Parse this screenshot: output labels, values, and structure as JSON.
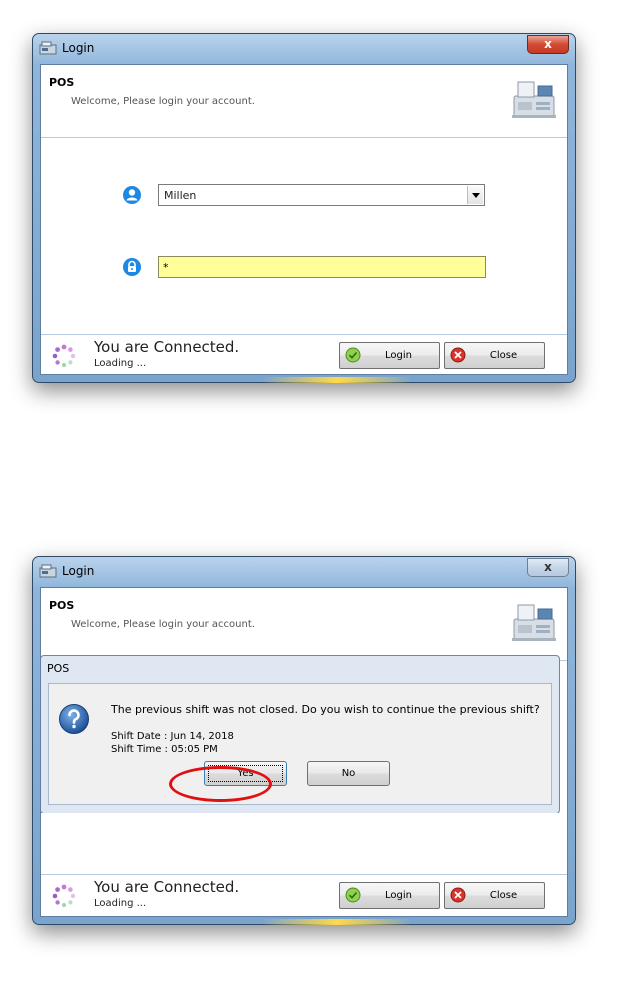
{
  "window": {
    "title": "Login",
    "close_glyph": "x",
    "icon": "login-app-icon"
  },
  "header": {
    "title": "POS",
    "subtitle": "Welcome, Please login your account."
  },
  "form": {
    "user_value": "Millen",
    "password_value": "*"
  },
  "footer": {
    "status": "You are Connected.",
    "loading": "Loading ...",
    "login_label": "Login",
    "close_label": "Close"
  },
  "dialog": {
    "title": "POS",
    "message": "The previous shift was not closed. Do you wish to continue the previous shift?",
    "shift_date": "Shift Date :  Jun 14, 2018",
    "shift_time": "Shift Time :  05:05 PM",
    "yes_label": "Yes",
    "no_label": "No"
  },
  "colors": {
    "accent_blue": "#1e88e5",
    "password_bg": "#ffff99",
    "close_red": "#d34a33",
    "highlight_red": "#e01010"
  }
}
